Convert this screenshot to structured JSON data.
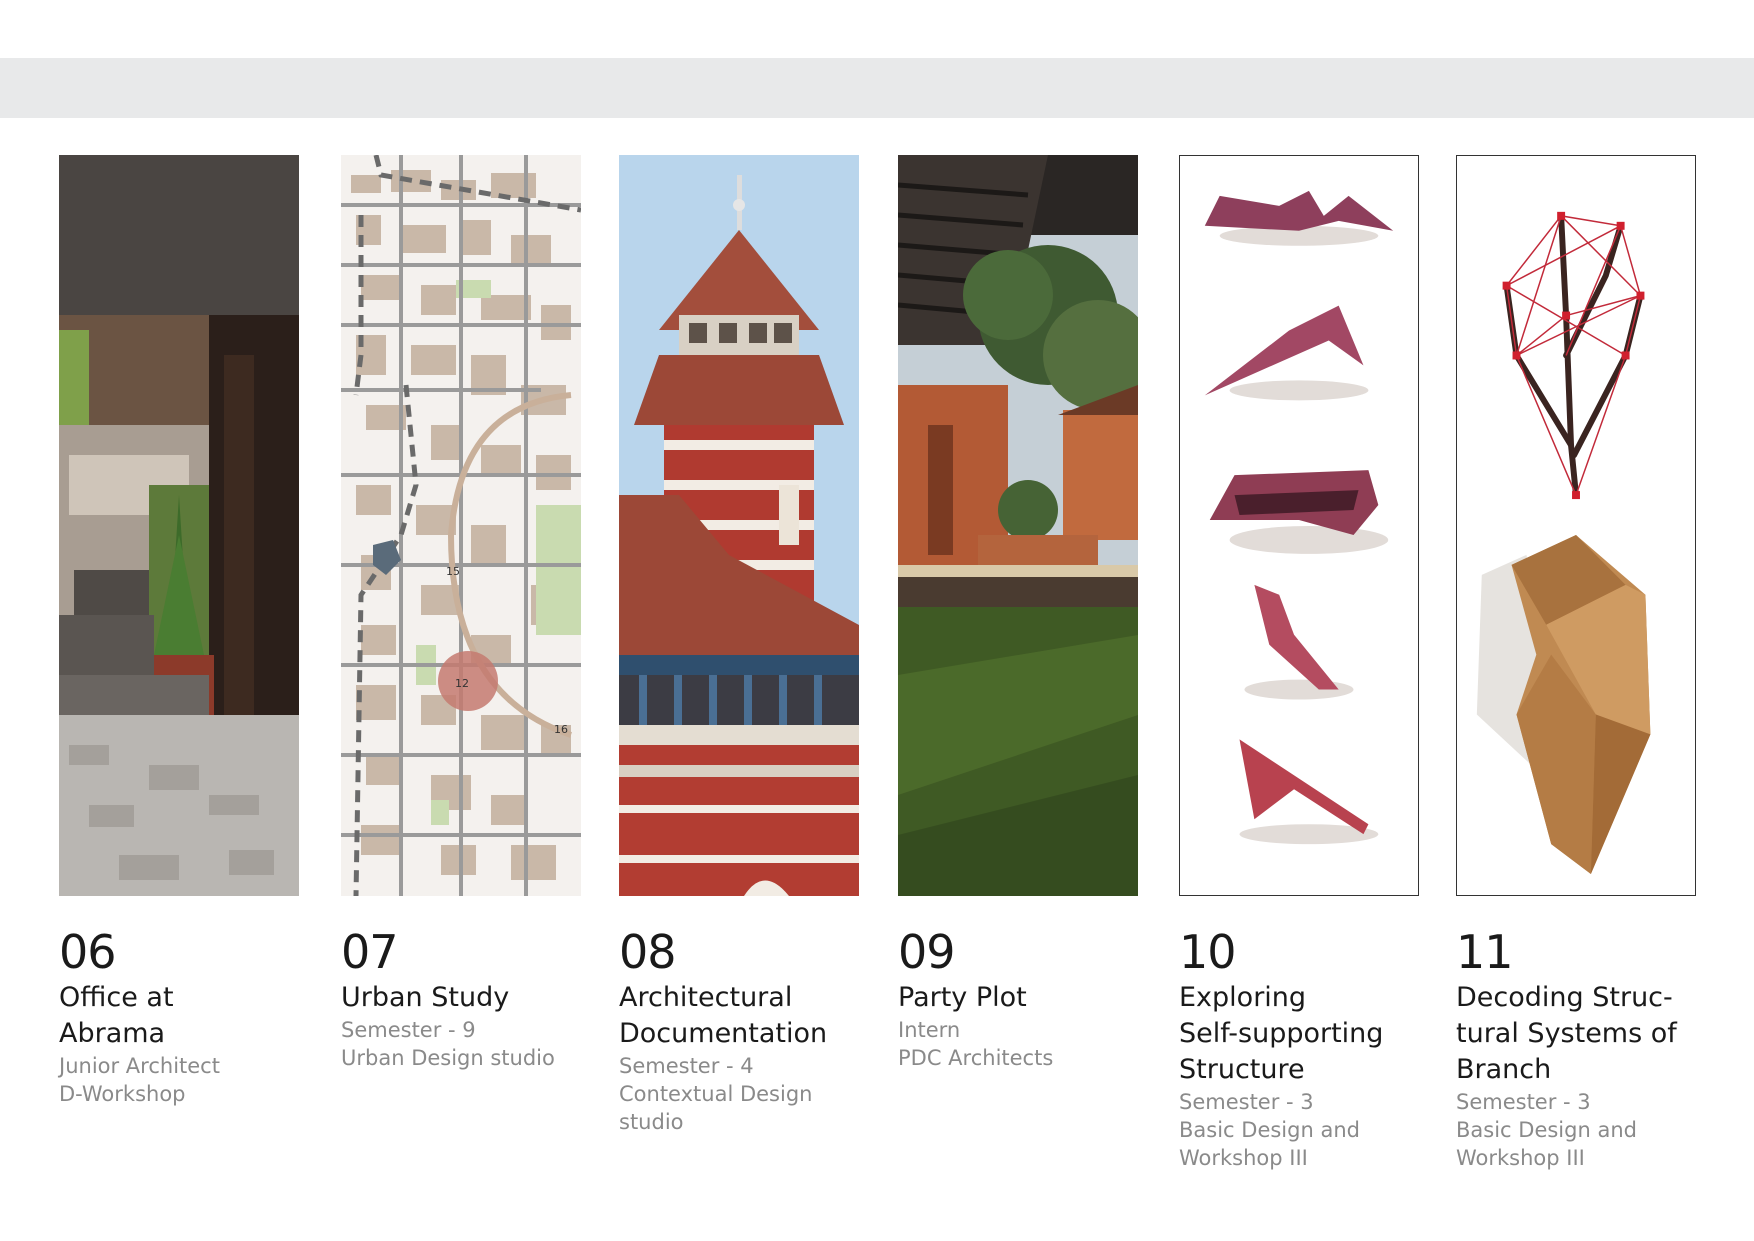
{
  "projects": [
    {
      "num": "06",
      "title_lines": [
        "Office at",
        "Abrama"
      ],
      "sub_lines": [
        "Junior Architect",
        "D-Workshop"
      ],
      "image": "office-interior-render"
    },
    {
      "num": "07",
      "title_lines": [
        "Urban Study"
      ],
      "sub_lines": [
        "Semester - 9",
        "Urban Design studio"
      ],
      "image": "urban-map"
    },
    {
      "num": "08",
      "title_lines": [
        "Architectural",
        "Documentation"
      ],
      "sub_lines": [
        "Semester - 4",
        "Contextual Design",
        "studio"
      ],
      "image": "clock-tower-photo"
    },
    {
      "num": "09",
      "title_lines": [
        "Party Plot"
      ],
      "sub_lines": [
        "Intern",
        "PDC Architects"
      ],
      "image": "party-plot-render"
    },
    {
      "num": "10",
      "title_lines": [
        "Exploring",
        "Self-supporting",
        "Structure"
      ],
      "sub_lines": [
        "Semester - 3",
        "Basic Design and",
        "Workshop III"
      ],
      "image": "folded-paper-models"
    },
    {
      "num": "11",
      "title_lines": [
        "Decoding Struc-",
        "tural Systems of",
        "Branch"
      ],
      "sub_lines": [
        "Semester - 3",
        "Basic Design and",
        "Workshop III"
      ],
      "image": "branch-structure-models"
    }
  ],
  "map_labels": [
    "15",
    "12",
    "16"
  ]
}
